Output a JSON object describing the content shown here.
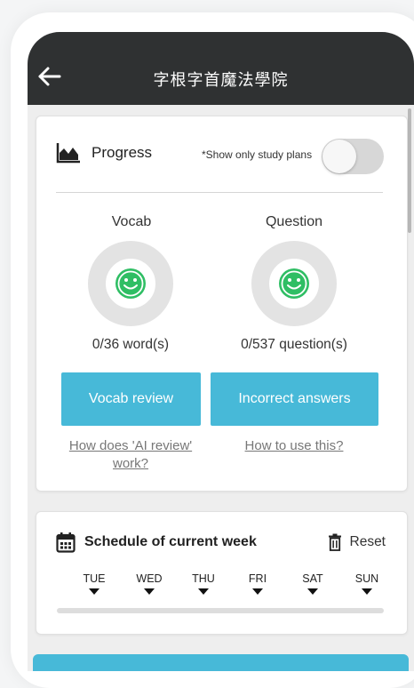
{
  "appbar": {
    "title": "字根字首魔法學院",
    "back_icon": "arrow-left-icon"
  },
  "progress": {
    "title": "Progress",
    "icon": "area-chart-icon",
    "toggle_label": "*Show only study plans",
    "toggle_on": false,
    "vocab": {
      "label": "Vocab",
      "count_text": "0/36 word(s)",
      "done": 0,
      "total": 36
    },
    "question": {
      "label": "Question",
      "count_text": "0/537 question(s)",
      "done": 0,
      "total": 537
    },
    "vocab_button": "Vocab review",
    "incorrect_button": "Incorrect answers",
    "ai_link": "How does 'AI review' work?",
    "howto_link": "How to use this?"
  },
  "schedule": {
    "title": "Schedule of current week",
    "icon": "calendar-icon",
    "reset_label": "Reset",
    "reset_icon": "trash-icon",
    "days": [
      "TUE",
      "WED",
      "THU",
      "FRI",
      "SAT",
      "SUN"
    ]
  },
  "colors": {
    "appbar": "#2f3132",
    "accent": "#47b9d8",
    "smile": "#2fbe64",
    "ring": "#e3e3e3"
  }
}
